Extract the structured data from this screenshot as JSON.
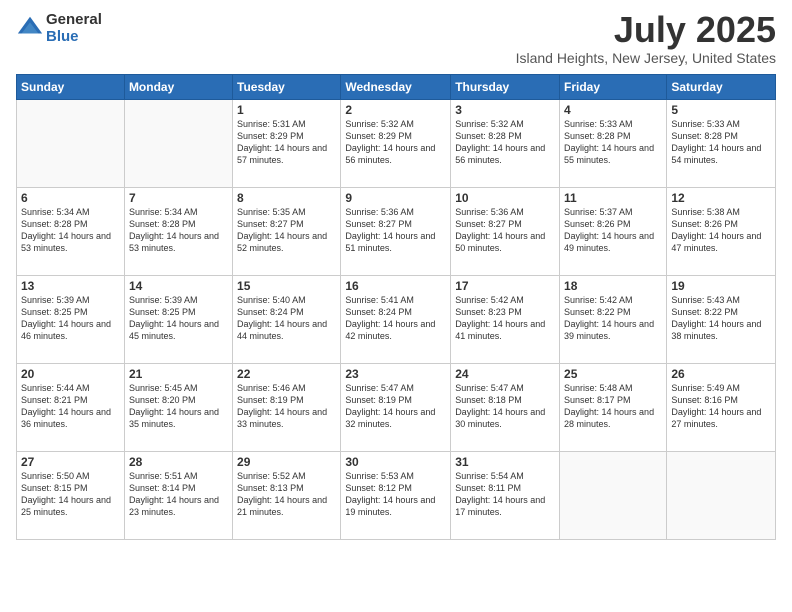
{
  "logo": {
    "general": "General",
    "blue": "Blue"
  },
  "title": {
    "month": "July 2025",
    "location": "Island Heights, New Jersey, United States"
  },
  "weekdays": [
    "Sunday",
    "Monday",
    "Tuesday",
    "Wednesday",
    "Thursday",
    "Friday",
    "Saturday"
  ],
  "weeks": [
    [
      {
        "day": "",
        "sunrise": "",
        "sunset": "",
        "daylight": ""
      },
      {
        "day": "",
        "sunrise": "",
        "sunset": "",
        "daylight": ""
      },
      {
        "day": "1",
        "sunrise": "Sunrise: 5:31 AM",
        "sunset": "Sunset: 8:29 PM",
        "daylight": "Daylight: 14 hours and 57 minutes."
      },
      {
        "day": "2",
        "sunrise": "Sunrise: 5:32 AM",
        "sunset": "Sunset: 8:29 PM",
        "daylight": "Daylight: 14 hours and 56 minutes."
      },
      {
        "day": "3",
        "sunrise": "Sunrise: 5:32 AM",
        "sunset": "Sunset: 8:28 PM",
        "daylight": "Daylight: 14 hours and 56 minutes."
      },
      {
        "day": "4",
        "sunrise": "Sunrise: 5:33 AM",
        "sunset": "Sunset: 8:28 PM",
        "daylight": "Daylight: 14 hours and 55 minutes."
      },
      {
        "day": "5",
        "sunrise": "Sunrise: 5:33 AM",
        "sunset": "Sunset: 8:28 PM",
        "daylight": "Daylight: 14 hours and 54 minutes."
      }
    ],
    [
      {
        "day": "6",
        "sunrise": "Sunrise: 5:34 AM",
        "sunset": "Sunset: 8:28 PM",
        "daylight": "Daylight: 14 hours and 53 minutes."
      },
      {
        "day": "7",
        "sunrise": "Sunrise: 5:34 AM",
        "sunset": "Sunset: 8:28 PM",
        "daylight": "Daylight: 14 hours and 53 minutes."
      },
      {
        "day": "8",
        "sunrise": "Sunrise: 5:35 AM",
        "sunset": "Sunset: 8:27 PM",
        "daylight": "Daylight: 14 hours and 52 minutes."
      },
      {
        "day": "9",
        "sunrise": "Sunrise: 5:36 AM",
        "sunset": "Sunset: 8:27 PM",
        "daylight": "Daylight: 14 hours and 51 minutes."
      },
      {
        "day": "10",
        "sunrise": "Sunrise: 5:36 AM",
        "sunset": "Sunset: 8:27 PM",
        "daylight": "Daylight: 14 hours and 50 minutes."
      },
      {
        "day": "11",
        "sunrise": "Sunrise: 5:37 AM",
        "sunset": "Sunset: 8:26 PM",
        "daylight": "Daylight: 14 hours and 49 minutes."
      },
      {
        "day": "12",
        "sunrise": "Sunrise: 5:38 AM",
        "sunset": "Sunset: 8:26 PM",
        "daylight": "Daylight: 14 hours and 47 minutes."
      }
    ],
    [
      {
        "day": "13",
        "sunrise": "Sunrise: 5:39 AM",
        "sunset": "Sunset: 8:25 PM",
        "daylight": "Daylight: 14 hours and 46 minutes."
      },
      {
        "day": "14",
        "sunrise": "Sunrise: 5:39 AM",
        "sunset": "Sunset: 8:25 PM",
        "daylight": "Daylight: 14 hours and 45 minutes."
      },
      {
        "day": "15",
        "sunrise": "Sunrise: 5:40 AM",
        "sunset": "Sunset: 8:24 PM",
        "daylight": "Daylight: 14 hours and 44 minutes."
      },
      {
        "day": "16",
        "sunrise": "Sunrise: 5:41 AM",
        "sunset": "Sunset: 8:24 PM",
        "daylight": "Daylight: 14 hours and 42 minutes."
      },
      {
        "day": "17",
        "sunrise": "Sunrise: 5:42 AM",
        "sunset": "Sunset: 8:23 PM",
        "daylight": "Daylight: 14 hours and 41 minutes."
      },
      {
        "day": "18",
        "sunrise": "Sunrise: 5:42 AM",
        "sunset": "Sunset: 8:22 PM",
        "daylight": "Daylight: 14 hours and 39 minutes."
      },
      {
        "day": "19",
        "sunrise": "Sunrise: 5:43 AM",
        "sunset": "Sunset: 8:22 PM",
        "daylight": "Daylight: 14 hours and 38 minutes."
      }
    ],
    [
      {
        "day": "20",
        "sunrise": "Sunrise: 5:44 AM",
        "sunset": "Sunset: 8:21 PM",
        "daylight": "Daylight: 14 hours and 36 minutes."
      },
      {
        "day": "21",
        "sunrise": "Sunrise: 5:45 AM",
        "sunset": "Sunset: 8:20 PM",
        "daylight": "Daylight: 14 hours and 35 minutes."
      },
      {
        "day": "22",
        "sunrise": "Sunrise: 5:46 AM",
        "sunset": "Sunset: 8:19 PM",
        "daylight": "Daylight: 14 hours and 33 minutes."
      },
      {
        "day": "23",
        "sunrise": "Sunrise: 5:47 AM",
        "sunset": "Sunset: 8:19 PM",
        "daylight": "Daylight: 14 hours and 32 minutes."
      },
      {
        "day": "24",
        "sunrise": "Sunrise: 5:47 AM",
        "sunset": "Sunset: 8:18 PM",
        "daylight": "Daylight: 14 hours and 30 minutes."
      },
      {
        "day": "25",
        "sunrise": "Sunrise: 5:48 AM",
        "sunset": "Sunset: 8:17 PM",
        "daylight": "Daylight: 14 hours and 28 minutes."
      },
      {
        "day": "26",
        "sunrise": "Sunrise: 5:49 AM",
        "sunset": "Sunset: 8:16 PM",
        "daylight": "Daylight: 14 hours and 27 minutes."
      }
    ],
    [
      {
        "day": "27",
        "sunrise": "Sunrise: 5:50 AM",
        "sunset": "Sunset: 8:15 PM",
        "daylight": "Daylight: 14 hours and 25 minutes."
      },
      {
        "day": "28",
        "sunrise": "Sunrise: 5:51 AM",
        "sunset": "Sunset: 8:14 PM",
        "daylight": "Daylight: 14 hours and 23 minutes."
      },
      {
        "day": "29",
        "sunrise": "Sunrise: 5:52 AM",
        "sunset": "Sunset: 8:13 PM",
        "daylight": "Daylight: 14 hours and 21 minutes."
      },
      {
        "day": "30",
        "sunrise": "Sunrise: 5:53 AM",
        "sunset": "Sunset: 8:12 PM",
        "daylight": "Daylight: 14 hours and 19 minutes."
      },
      {
        "day": "31",
        "sunrise": "Sunrise: 5:54 AM",
        "sunset": "Sunset: 8:11 PM",
        "daylight": "Daylight: 14 hours and 17 minutes."
      },
      {
        "day": "",
        "sunrise": "",
        "sunset": "",
        "daylight": ""
      },
      {
        "day": "",
        "sunrise": "",
        "sunset": "",
        "daylight": ""
      }
    ]
  ]
}
